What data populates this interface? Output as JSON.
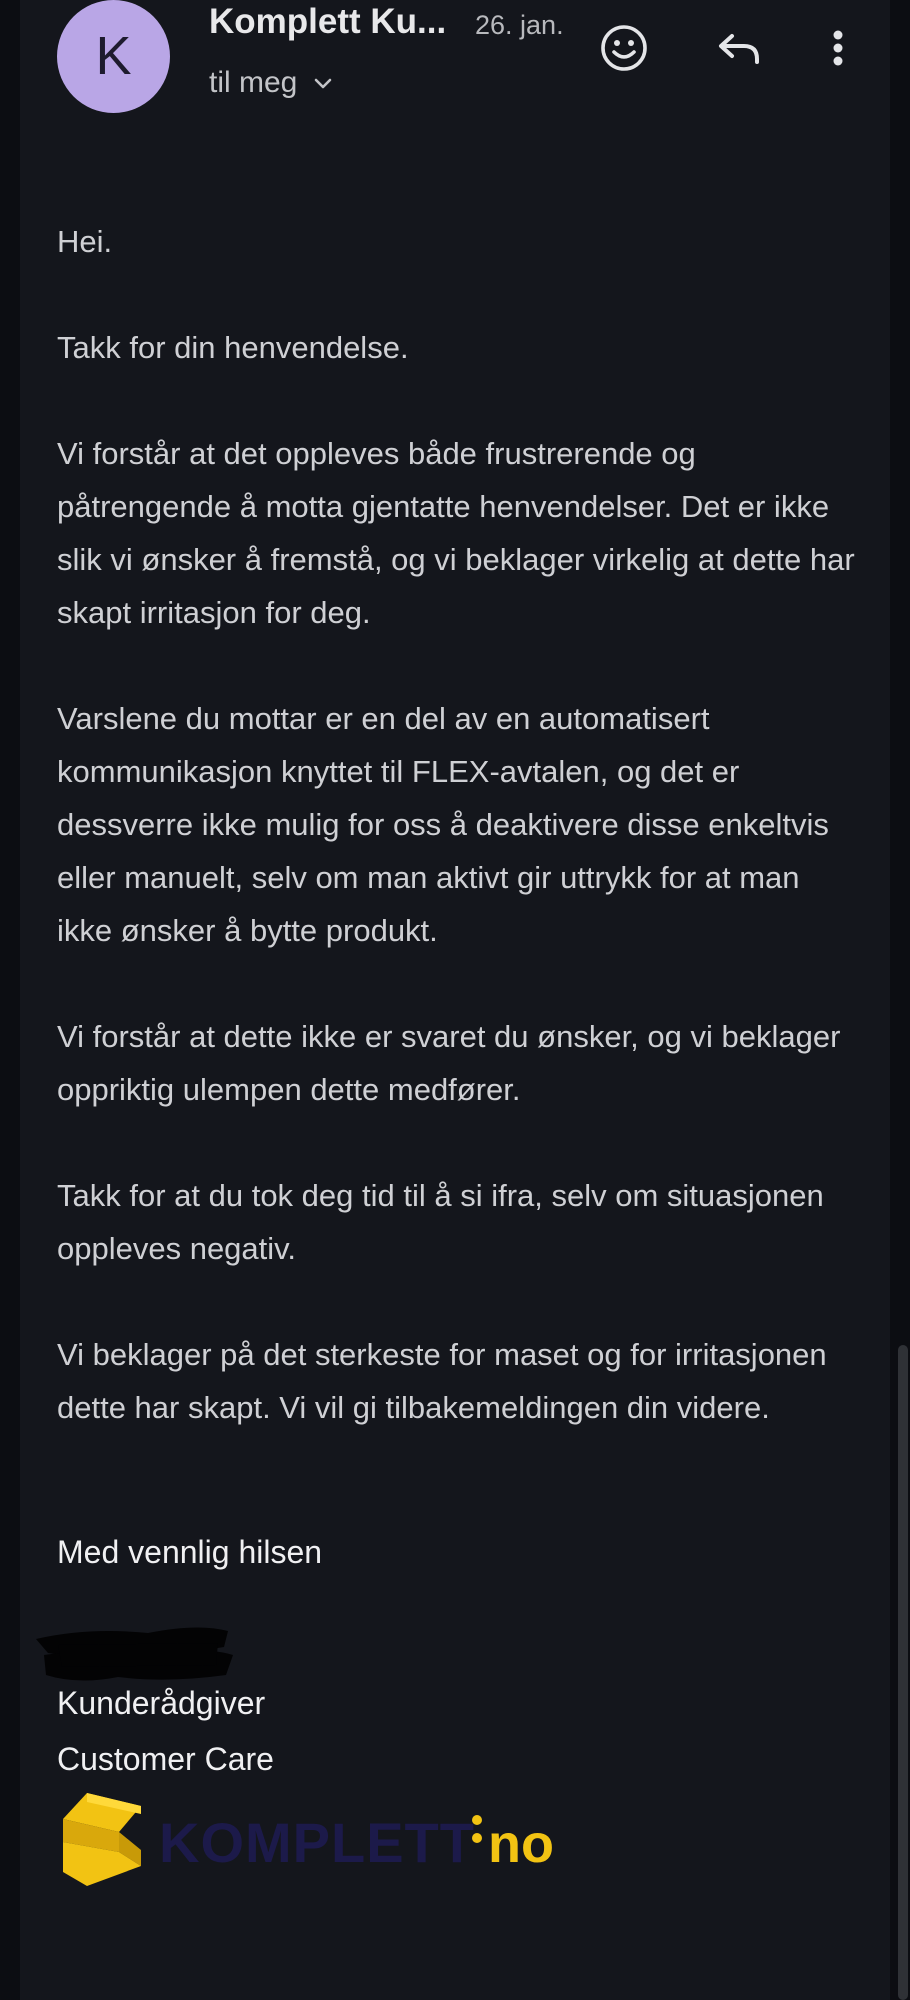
{
  "header": {
    "avatar_letter": "K",
    "sender": "Komplett Ku...",
    "date": "26. jan.",
    "recipient": "til meg",
    "icons": [
      "smiley-icon",
      "reply-icon",
      "more-vert-icon"
    ]
  },
  "message": {
    "paragraphs": [
      "Hei.",
      "Takk for din henvendelse.",
      "Vi forstår at det oppleves både frustrerende og påtrengende å motta gjentatte henvendelser. Det er ikke slik vi ønsker å fremstå, og vi beklager virkelig at dette har skapt irritasjon for deg.",
      "Varslene du mottar er en del av en automatisert kommunikasjon knyttet til FLEX-avtalen, og det er dessverre ikke mulig for oss å deaktivere disse enkeltvis eller manuelt, selv om man aktivt gir uttrykk for at man ikke ønsker å bytte produkt.",
      "Vi forstår at dette ikke er svaret du ønsker, og vi beklager oppriktig ulempen dette medfører.",
      "Takk for at du tok deg tid til å si ifra, selv om situasjonen oppleves negativ.",
      "Vi beklager på det sterkeste for maset og for irritasjonen dette har skapt. Vi vil gi tilbakemeldingen din videre."
    ],
    "closing": "Med vennlig hilsen",
    "role": "Kunderådgiver",
    "department": "Customer Care",
    "logo_text": "KOMPLETT.no"
  },
  "colors": {
    "background": "#14161c",
    "avatar": "#b9a6e6",
    "logo_yellow": "#f2c313",
    "logo_navy": "#1c1a4a"
  }
}
